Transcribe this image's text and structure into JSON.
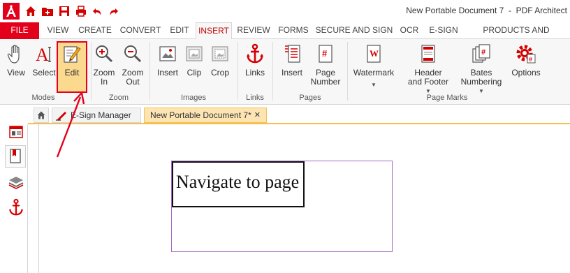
{
  "window": {
    "title": "New Portable Document 7  -  PDF Architect"
  },
  "quick_access": [
    {
      "name": "app-logo-icon"
    },
    {
      "name": "home-icon"
    },
    {
      "name": "open-folder-icon"
    },
    {
      "name": "save-icon"
    },
    {
      "name": "print-icon"
    },
    {
      "name": "undo-icon"
    },
    {
      "name": "redo-icon"
    }
  ],
  "tabs": [
    {
      "label": "FILE"
    },
    {
      "label": "VIEW"
    },
    {
      "label": "CREATE"
    },
    {
      "label": "CONVERT"
    },
    {
      "label": "EDIT"
    },
    {
      "label": "INSERT"
    },
    {
      "label": "REVIEW"
    },
    {
      "label": "FORMS"
    },
    {
      "label": "SECURE AND SIGN"
    },
    {
      "label": "OCR"
    },
    {
      "label": "E-SIGN"
    },
    {
      "label": "PRODUCTS AND PRICING"
    }
  ],
  "ribbon": {
    "buttons": [
      {
        "label": "View"
      },
      {
        "label": "Select"
      },
      {
        "label": "Edit"
      },
      {
        "label": "Zoom\nIn"
      },
      {
        "label": "Zoom\nOut"
      },
      {
        "label": "Insert"
      },
      {
        "label": "Clip"
      },
      {
        "label": "Crop"
      },
      {
        "label": "Links"
      },
      {
        "label": "Insert"
      },
      {
        "label": "Page\nNumber"
      },
      {
        "label": "Watermark"
      },
      {
        "label": "Header\nand Footer"
      },
      {
        "label": "Bates\nNumbering"
      },
      {
        "label": "Options"
      }
    ],
    "groups": [
      {
        "label": "Modes"
      },
      {
        "label": "Zoom"
      },
      {
        "label": "Images"
      },
      {
        "label": "Links"
      },
      {
        "label": "Pages"
      },
      {
        "label": "Page Marks"
      }
    ]
  },
  "doc_tabs": [
    {
      "label": "E-Sign Manager"
    },
    {
      "label": "New Portable Document 7*"
    }
  ],
  "document": {
    "text": "Navigate to page"
  },
  "colors": {
    "brand": "#e3001b",
    "accent_tab": "#c00000",
    "highlight": "#fbd98f",
    "active_doc_tab": "#fde5b3"
  }
}
